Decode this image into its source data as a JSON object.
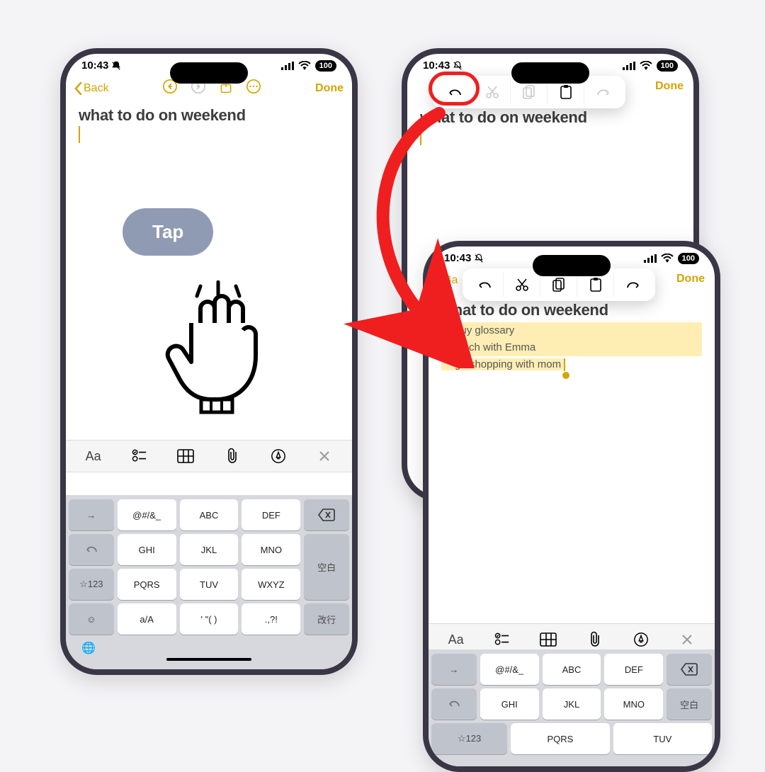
{
  "status": {
    "time": "10:43",
    "battery": "100"
  },
  "nav": {
    "back": "Back",
    "done": "Done"
  },
  "note": {
    "title": "what to do on weekend",
    "items": [
      "buy glossary",
      "lunch with Emma",
      "go shopping with mom"
    ]
  },
  "tap_label": "Tap",
  "keyboard": {
    "r1": [
      "@#/&_",
      "ABC",
      "DEF"
    ],
    "r2": [
      "GHI",
      "JKL",
      "MNO"
    ],
    "r3": [
      "PQRS",
      "TUV",
      "WXYZ"
    ],
    "r4": [
      "a/A",
      "' \"( )",
      ".,?!"
    ],
    "side": {
      "num": "☆123",
      "space": "空白",
      "return": "改行"
    }
  },
  "format_icons": [
    "Aa"
  ]
}
